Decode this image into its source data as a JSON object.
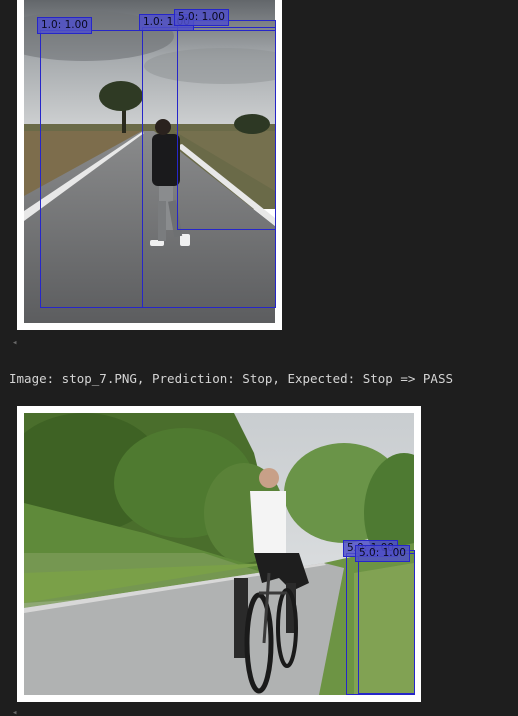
{
  "output": {
    "result_line": "Image: stop_7.PNG, Prediction: Stop, Expected: Stop => PASS"
  },
  "image_1": {
    "detections": [
      {
        "label": "1.0: 1.00"
      },
      {
        "label": "1.0: 1.00"
      },
      {
        "label": "5.0: 1.00"
      }
    ]
  },
  "image_2": {
    "detections": [
      {
        "label": "5.0: 1.00"
      },
      {
        "label": "5.0: 1.00"
      }
    ]
  },
  "scroll_marker": "◂"
}
